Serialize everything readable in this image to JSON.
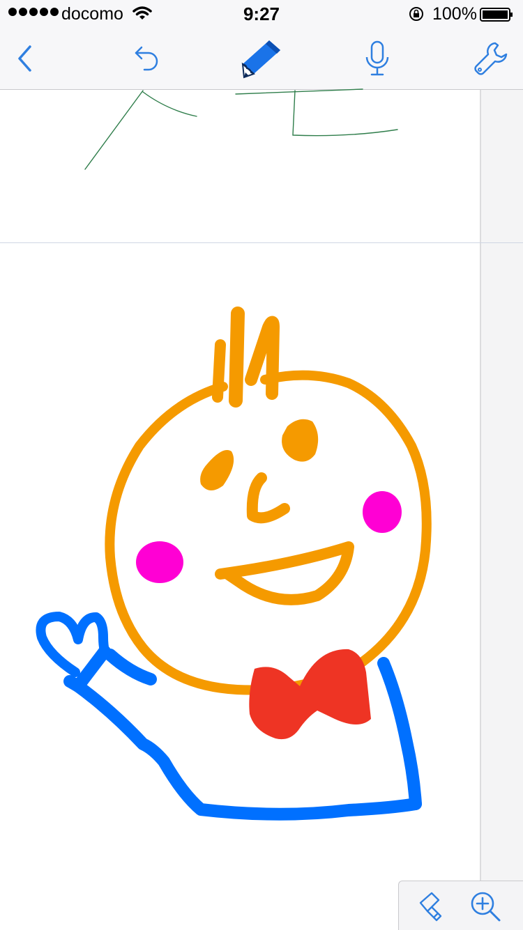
{
  "status_bar": {
    "carrier": "docomo",
    "time": "9:27",
    "battery_percent": "100%",
    "signal_dots": 5
  },
  "toolbar": {
    "back_icon": "chevron-left-icon",
    "undo_icon": "undo-icon",
    "pen_icon": "pencil-icon",
    "mic_icon": "microphone-icon",
    "settings_icon": "wrench-icon",
    "accent_color": "#2f7fe0"
  },
  "bottom_tools": {
    "eraser_icon": "eraser-icon",
    "zoom_icon": "zoom-in-icon"
  },
  "drawing": {
    "stroke_colors": {
      "face": "#f59a00",
      "cheeks": "#ff00d4",
      "bowtie": "#ee3424",
      "body": "#0070ff",
      "handwriting": "#2e7d4a"
    }
  }
}
